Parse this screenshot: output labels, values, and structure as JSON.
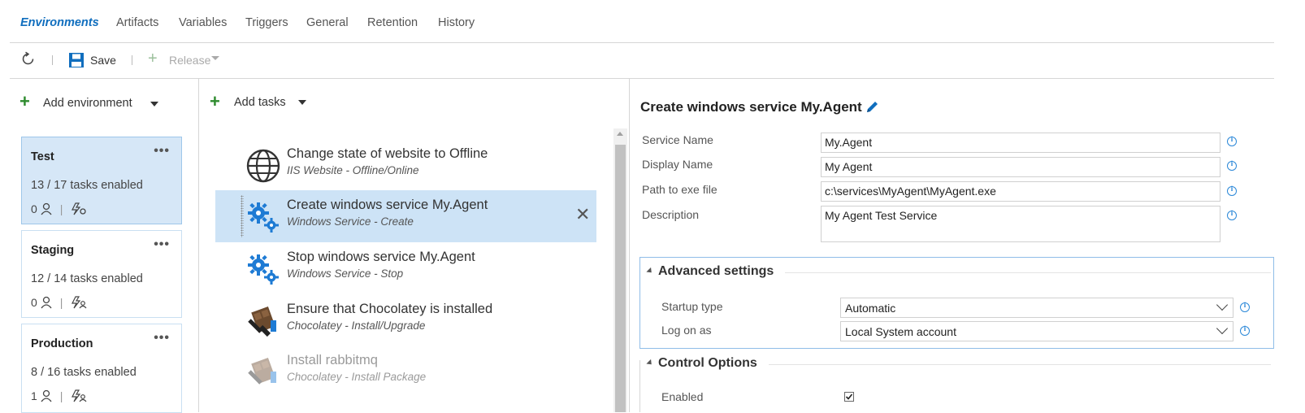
{
  "tabs": [
    "Environments",
    "Artifacts",
    "Variables",
    "Triggers",
    "General",
    "Retention",
    "History"
  ],
  "toolbar": {
    "save_label": "Save",
    "release_label": "Release"
  },
  "environments": {
    "add_label": "Add environment",
    "items": [
      {
        "name": "Test",
        "tasks": "13 / 17 tasks enabled",
        "approvers": "0",
        "selected": true
      },
      {
        "name": "Staging",
        "tasks": "12 / 14 tasks enabled",
        "approvers": "0",
        "selected": false
      },
      {
        "name": "Production",
        "tasks": "8 / 16 tasks enabled",
        "approvers": "1",
        "selected": false
      }
    ]
  },
  "tasks": {
    "add_label": "Add tasks",
    "items": [
      {
        "title": "Change state of website to Offline",
        "subtitle": "IIS Website - Offline/Online",
        "icon": "globe-icon"
      },
      {
        "title": "Create windows service My.Agent",
        "subtitle": "Windows Service - Create",
        "icon": "gears-icon",
        "selected": true
      },
      {
        "title": "Stop windows service My.Agent",
        "subtitle": "Windows Service - Stop",
        "icon": "gears-icon"
      },
      {
        "title": "Ensure that Chocolatey is installed",
        "subtitle": "Chocolatey - Install/Upgrade",
        "icon": "chocolatey-icon"
      },
      {
        "title": "Install rabbitmq",
        "subtitle": "Chocolatey - Install Package",
        "icon": "chocolatey-icon",
        "disabled": true
      }
    ]
  },
  "detail": {
    "title": "Create windows service My.Agent",
    "fields": [
      {
        "label": "Service Name",
        "value": "My.Agent"
      },
      {
        "label": "Display Name",
        "value": "My Agent"
      },
      {
        "label": "Path to exe file",
        "value": "c:\\services\\MyAgent\\MyAgent.exe"
      },
      {
        "label": "Description",
        "value": "My Agent Test Service"
      }
    ],
    "advanced": {
      "title": "Advanced settings",
      "startup_label": "Startup type",
      "startup_value": "Automatic",
      "logon_label": "Log on as",
      "logon_value": "Local System account"
    },
    "control": {
      "title": "Control Options",
      "enabled_label": "Enabled",
      "enabled": true
    }
  },
  "colors": {
    "accent": "#106ebe",
    "selected_bg": "#cde3f6",
    "add_green": "#2e8b2e"
  }
}
